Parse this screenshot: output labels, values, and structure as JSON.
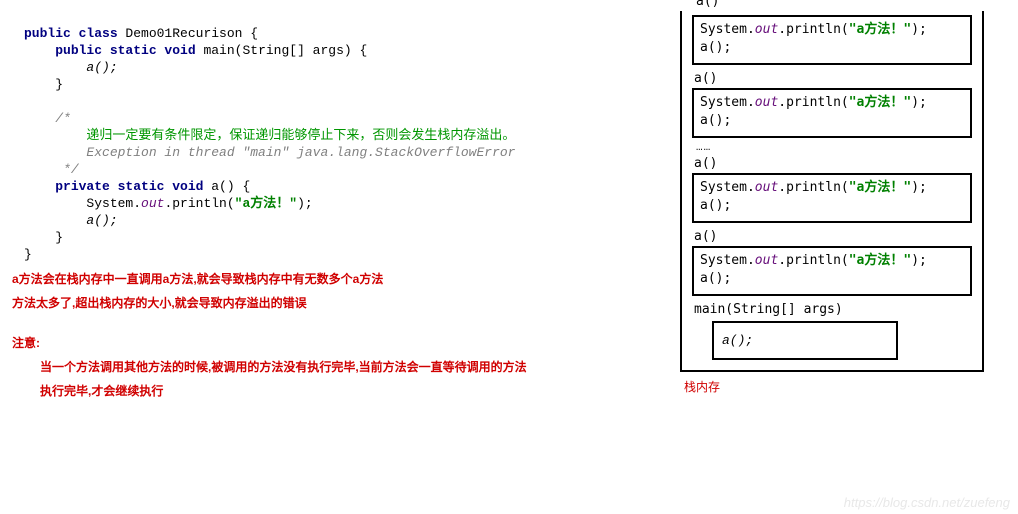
{
  "code": {
    "l1a": "public class",
    "l1b": " Demo01Recurison {",
    "l2a": "public static void",
    "l2b": " main(String[] args) {",
    "l3": "a();",
    "l4": "}",
    "c1": "/*",
    "c2": "  递归一定要有条件限定，保证递归能够停止下来，否则会发生栈内存溢出。",
    "c3": "  Exception in thread \"main\" java.lang.StackOverflowError",
    "c4": " */",
    "l5a": "private static void",
    "l5b": " a() {",
    "l6a": "System.",
    "l6b": "out",
    "l6c": ".println(",
    "l6d": "\"a方法！\"",
    "l6e": ");",
    "l7": "a();",
    "l8": "}",
    "l9": "}"
  },
  "warn": {
    "w1": "a方法会在栈内存中一直调用a方法,就会导致栈内存中有无数多个a方法",
    "w2": "方法太多了,超出栈内存的大小,就会导致内存溢出的错误",
    "note": "注意:",
    "w3": "当一个方法调用其他方法的时候,被调用的方法没有执行完毕,当前方法会一直等待调用的方法",
    "w4": "执行完毕,才会继续执行"
  },
  "stack": {
    "hanging": "a()",
    "alabel": "a()",
    "printA": "System.",
    "printB": "out",
    "printC": ".println(",
    "printD": "\"a方法！\"",
    "printE": ");",
    "call": "a();",
    "dots": "……",
    "main": "main(String[] args)",
    "maincall": "a();",
    "label": "栈内存"
  },
  "watermark": "https://blog.csdn.net/zuefeng"
}
